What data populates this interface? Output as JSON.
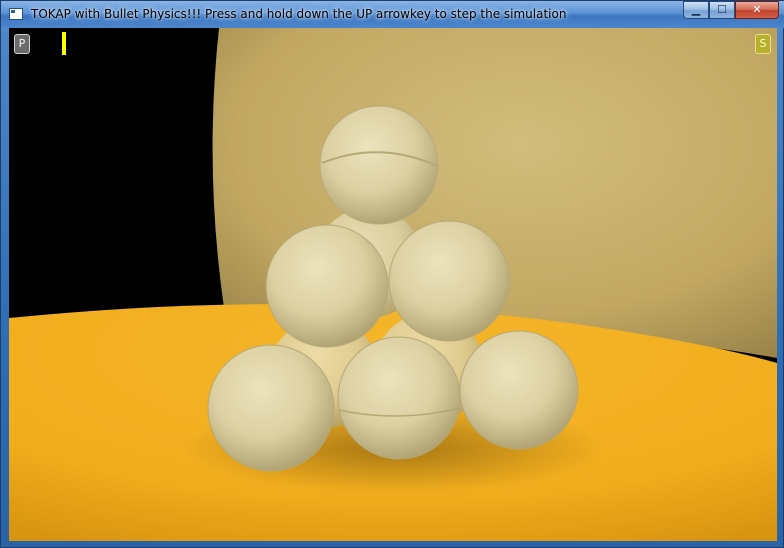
{
  "window": {
    "title": "TOKAP with Bullet Physics!!! Press and hold down the UP arrowkey to step the simulation",
    "minimize_glyph": "▁",
    "maximize_glyph": "☐",
    "close_glyph": "✕"
  },
  "viewport": {
    "left_button_label": "P",
    "right_button_label": "S",
    "marker_color": "#ffff00",
    "floor_color": "#f2b122",
    "wall_color": "#c8b06a",
    "sphere_color": "#ddd3a8",
    "sphere_count": 10
  }
}
